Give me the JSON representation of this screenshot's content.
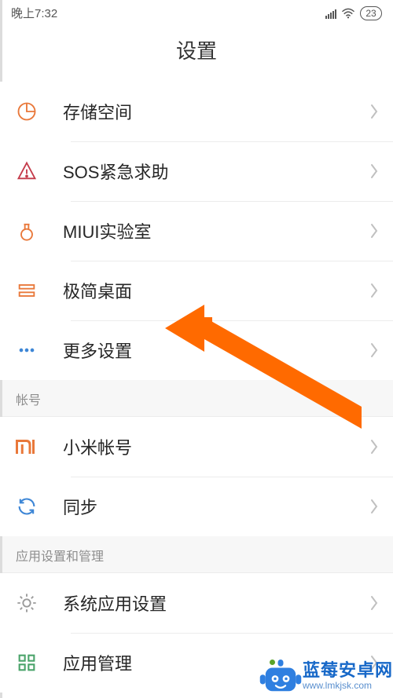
{
  "status": {
    "time": "晚上7:32",
    "battery": "23"
  },
  "title": "设置",
  "groups": [
    {
      "header": null,
      "items": [
        {
          "label": "存储空间",
          "icon": "pie"
        },
        {
          "label": "SOS紧急求助",
          "icon": "warn"
        },
        {
          "label": "MIUI实验室",
          "icon": "flask"
        },
        {
          "label": "极简桌面",
          "icon": "layout"
        },
        {
          "label": "更多设置",
          "icon": "dots"
        }
      ]
    },
    {
      "header": "帐号",
      "items": [
        {
          "label": "小米帐号",
          "icon": "mi"
        },
        {
          "label": "同步",
          "icon": "sync"
        }
      ]
    },
    {
      "header": "应用设置和管理",
      "items": [
        {
          "label": "系统应用设置",
          "icon": "gear"
        },
        {
          "label": "应用管理",
          "icon": "grid"
        }
      ]
    }
  ],
  "watermark": {
    "brand": "蓝莓安卓网",
    "url": "www.lmkjsk.com"
  }
}
